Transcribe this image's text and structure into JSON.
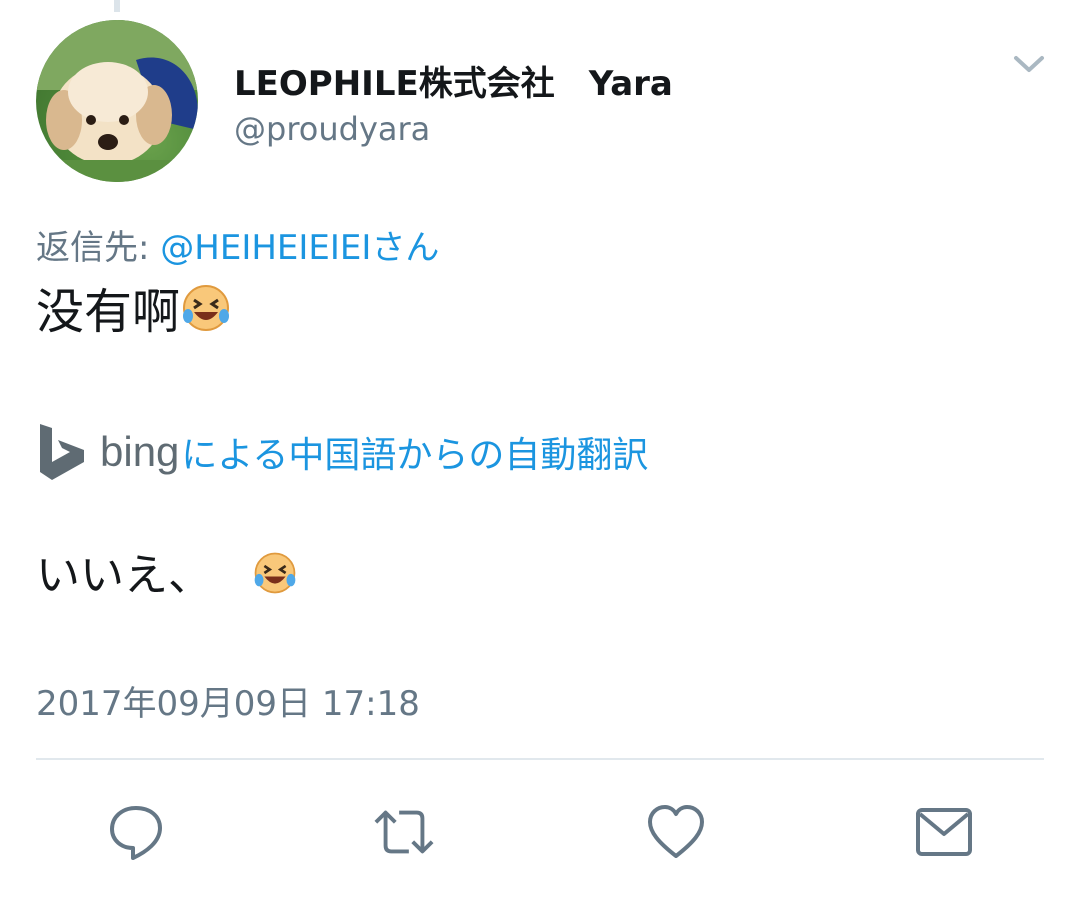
{
  "tweet": {
    "author": {
      "display_name": "LEOPHILE株式会社　Yara",
      "handle": "@proudyara",
      "avatar_icon": "puppy-avatar"
    },
    "reply_to": {
      "prefix": "返信先: ",
      "mention": "@HEIHEIEIEIさん"
    },
    "text": "没有啊",
    "text_emoji": "laughing-tears-emoji",
    "translation": {
      "provider_word": "bing",
      "link_text": "による中国語からの自動翻訳",
      "translated_text": "いいえ、",
      "translated_emoji": "laughing-tears-emoji"
    },
    "timestamp": "2017年09月09日 17:18"
  },
  "actions": [
    {
      "name": "reply",
      "icon": "reply-icon"
    },
    {
      "name": "retweet",
      "icon": "retweet-icon"
    },
    {
      "name": "like",
      "icon": "heart-icon"
    },
    {
      "name": "share",
      "icon": "mail-icon"
    }
  ],
  "colors": {
    "text_primary": "#14171a",
    "text_secondary": "#657786",
    "link": "#1b95e0",
    "icon": "#657786"
  }
}
